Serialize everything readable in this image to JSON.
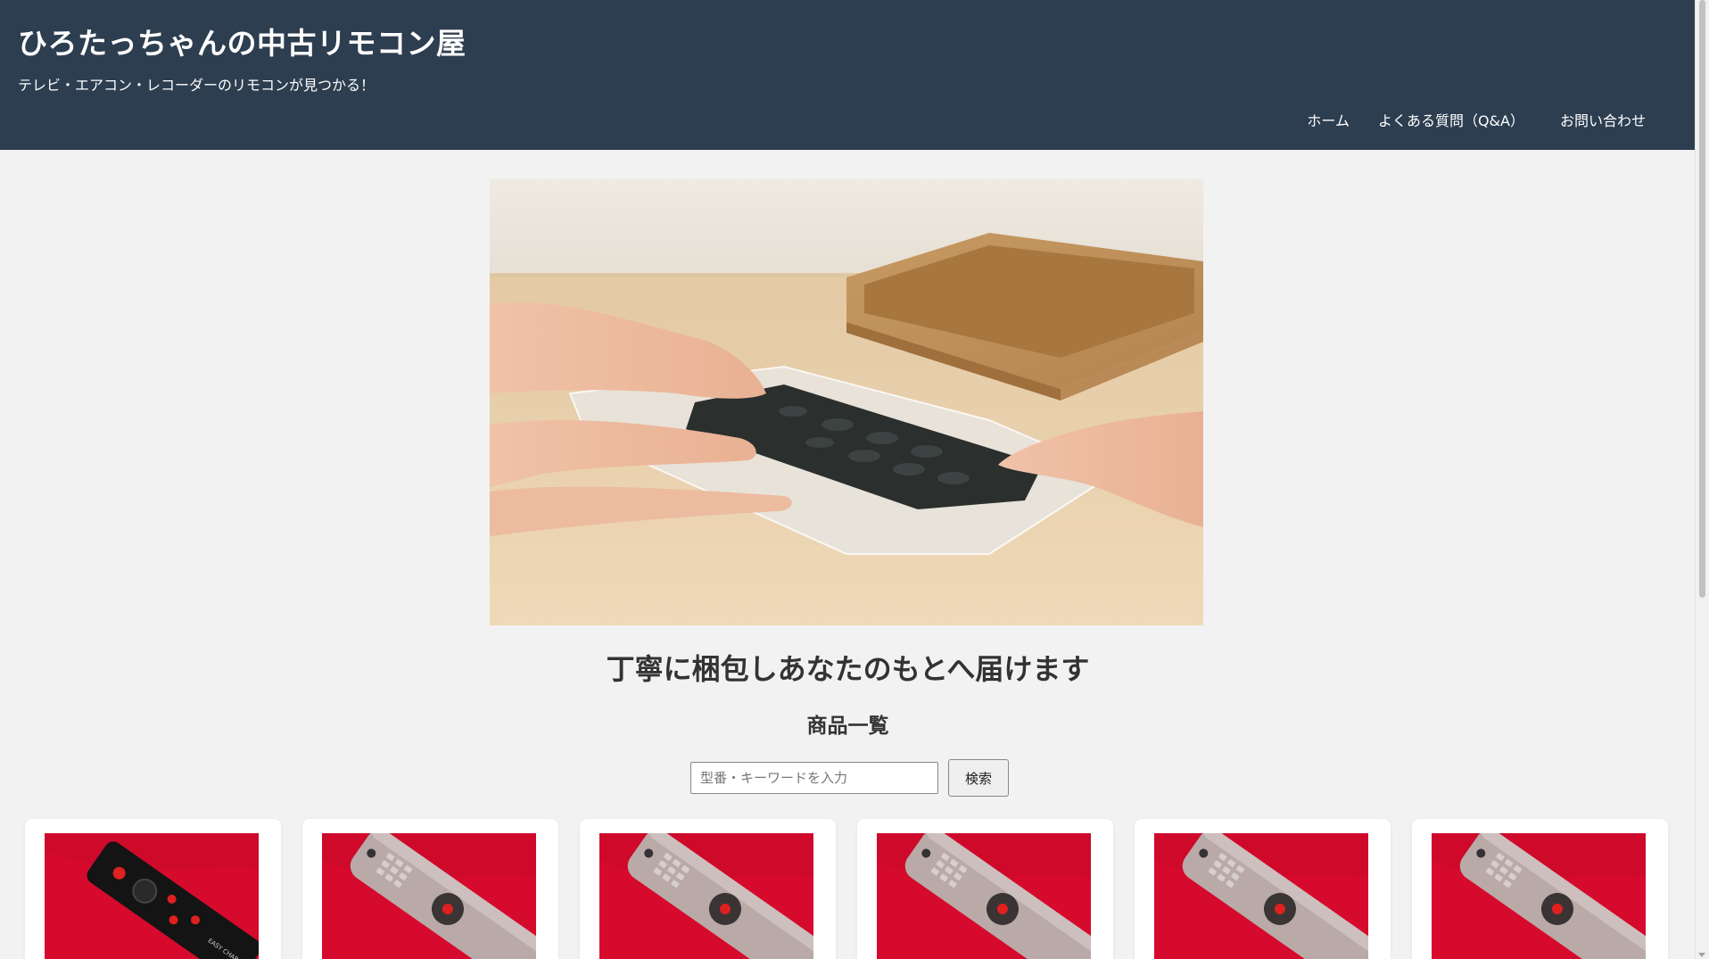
{
  "header": {
    "site_title": "ひろたっちゃんの中古リモコン屋",
    "tagline": "テレビ・エアコン・レコーダーのリモコンが見つかる！",
    "nav": [
      {
        "label": "ホーム"
      },
      {
        "label": "よくある質問（Q&A）"
      },
      {
        "label": "お問い合わせ"
      }
    ]
  },
  "hero": {
    "heading": "丁寧に梱包しあなたのもとへ届けます"
  },
  "products_section": {
    "heading": "商品一覧",
    "search_placeholder": "型番・キーワードを入力",
    "search_value": "",
    "search_button_label": "検索",
    "products": [
      {
        "image": "black-remote-photo",
        "brand_print": "EASY CHARGE"
      },
      {
        "image": "silver-remote-photo"
      },
      {
        "image": "silver-remote-photo"
      },
      {
        "image": "silver-remote-photo"
      },
      {
        "image": "silver-remote-photo"
      },
      {
        "image": "silver-remote-photo"
      }
    ]
  },
  "colors": {
    "header_bg": "#2d3e50",
    "page_bg": "#f2f2f2",
    "product_bg_red": "#d60a2c"
  }
}
